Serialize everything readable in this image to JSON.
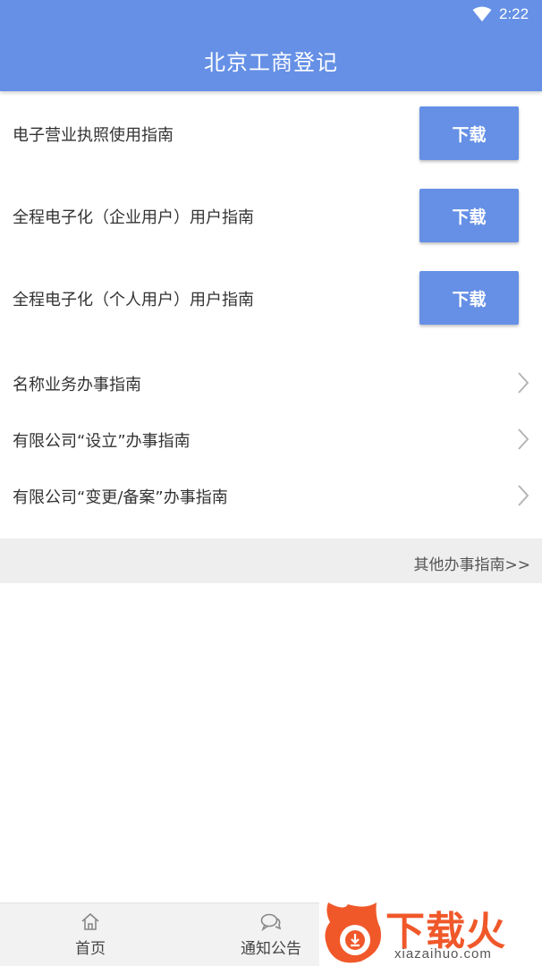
{
  "status_bar": {
    "time": "2:22",
    "wifi_icon": "wifi-icon"
  },
  "header": {
    "title": "北京工商登记"
  },
  "downloads": [
    {
      "label": "电子营业执照使用指南",
      "button": "下载"
    },
    {
      "label": "全程电子化（企业用户）用户指南",
      "button": "下载"
    },
    {
      "label": "全程电子化（个人用户）用户指南",
      "button": "下载"
    }
  ],
  "guides": [
    {
      "label": "名称业务办事指南",
      "icon": "chevron-right-icon"
    },
    {
      "label": "有限公司“设立”办事指南",
      "icon": "chevron-right-icon"
    },
    {
      "label": "有限公司“变更/备案”办事指南",
      "icon": "chevron-right-icon"
    }
  ],
  "other_link": "其他办事指南>>",
  "tabs": [
    {
      "label": "首页",
      "icon": "home-icon"
    },
    {
      "label": "通知公告",
      "icon": "chat-bubbles-icon"
    }
  ],
  "watermark": {
    "text": "下载火",
    "url": "xiazaihuo.com"
  },
  "colors": {
    "primary": "#6590e6",
    "watermark": "#f0582a"
  }
}
